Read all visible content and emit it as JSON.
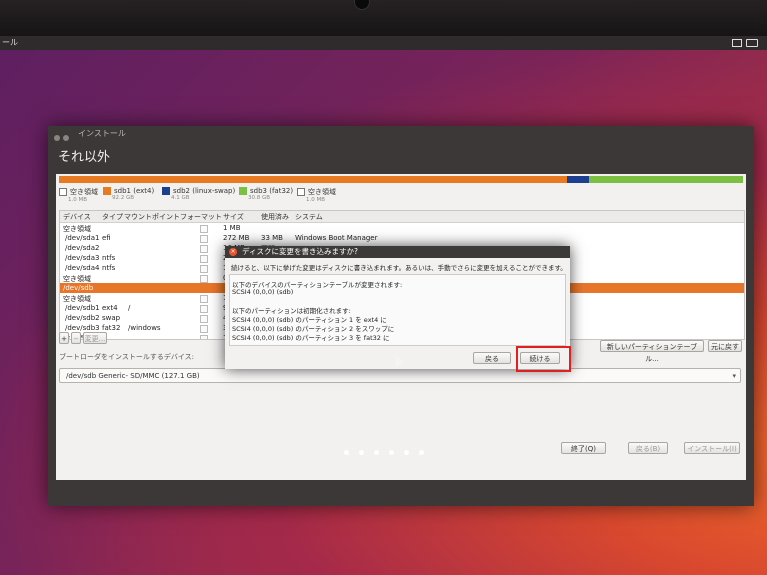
{
  "topbar": {
    "left": "ール"
  },
  "window": {
    "title": "インストール",
    "heading": "それ以外"
  },
  "legend": [
    {
      "name": "空き領域",
      "size": "1.0 MB",
      "color": "#ffffff"
    },
    {
      "name": "sdb1 (ext4)",
      "size": "92.2 GB",
      "color": "#e87a22"
    },
    {
      "name": "sdb2 (linux-swap)",
      "size": "4.1 GB",
      "color": "#1c3f8f"
    },
    {
      "name": "sdb3 (fat32)",
      "size": "30.8 GB",
      "color": "#7bc043"
    },
    {
      "name": "空き領域",
      "size": "1.0 MB",
      "color": "#ffffff"
    }
  ],
  "table": {
    "headers": [
      "デバイス",
      "タイプ",
      "マウントポイント",
      "フォーマット",
      "サイズ",
      "使用済み",
      "システム"
    ],
    "rows": [
      {
        "device": "空き領域",
        "type": "",
        "mount": "",
        "size": "1 MB",
        "used": "",
        "system": ""
      },
      {
        "device": "/dev/sda1",
        "type": "efi",
        "mount": "",
        "size": "272 MB",
        "used": "33 MB",
        "system": "Windows Boot Manager"
      },
      {
        "device": "/dev/sda2",
        "type": "",
        "mount": "",
        "size": "16 MB",
        "used": "不明",
        "system": ""
      },
      {
        "device": "/dev/sda3",
        "type": "ntfs",
        "mount": "",
        "size": "2",
        "used": "",
        "system": ""
      },
      {
        "device": "/dev/sda4",
        "type": "ntfs",
        "mount": "",
        "size": "1(",
        "used": "",
        "system": ""
      },
      {
        "device": "空き領域",
        "type": "",
        "mount": "",
        "size": "0",
        "used": "",
        "system": ""
      },
      {
        "device": "/dev/sdb",
        "type": "",
        "mount": "",
        "size": "",
        "used": "",
        "system": ""
      },
      {
        "device": "空き領域",
        "type": "",
        "mount": "",
        "size": "1",
        "used": "",
        "system": ""
      },
      {
        "device": "/dev/sdb1",
        "type": "ext4",
        "mount": "/",
        "size": "9",
        "used": "",
        "system": ""
      },
      {
        "device": "/dev/sdb2",
        "type": "swap",
        "mount": "",
        "size": "4",
        "used": "",
        "system": ""
      },
      {
        "device": "/dev/sdb3",
        "type": "fat32",
        "mount": "/windows",
        "size": "3",
        "used": "",
        "system": ""
      },
      {
        "device": "空き領域",
        "type": "",
        "mount": "",
        "size": "1",
        "used": "",
        "system": ""
      }
    ]
  },
  "table_buttons": {
    "add": "+",
    "remove": "−",
    "change": "変更..."
  },
  "right_buttons": {
    "new_table": "新しいパーティションテーブル...",
    "revert": "元に戻す"
  },
  "bootloader": {
    "label": "ブートローダをインストールするデバイス:",
    "value": "/dev/sdb   Generic- SD/MMC (127.1 GB)"
  },
  "footer_buttons": {
    "quit": "終了(Q)",
    "back": "戻る(B)",
    "install": "インストール(I)"
  },
  "dialog": {
    "title": "ディスクに変更を書き込みますか?",
    "intro": "続けると、以下に挙げた変更はディスクに書き込まれます。あるいは、手動でさらに変更を加えることができます。",
    "lines": [
      "以下のデバイスのパーティションテーブルが変更されます:",
      "SCSI4 (0,0,0) (sdb)",
      "",
      "以下のパーティションは初期化されます:",
      "SCSI4 (0,0,0) (sdb) のパーティション 1 を ext4 に",
      "SCSI4 (0,0,0) (sdb) のパーティション 2 をスワップに",
      "SCSI4 (0,0,0) (sdb) のパーティション 3 を fat32 に"
    ],
    "back_label": "戻る",
    "continue_label": "続ける"
  },
  "colors": {
    "accent": "#e87a22",
    "dialog_close": "#e9532b",
    "highlight_box": "#e02020"
  }
}
